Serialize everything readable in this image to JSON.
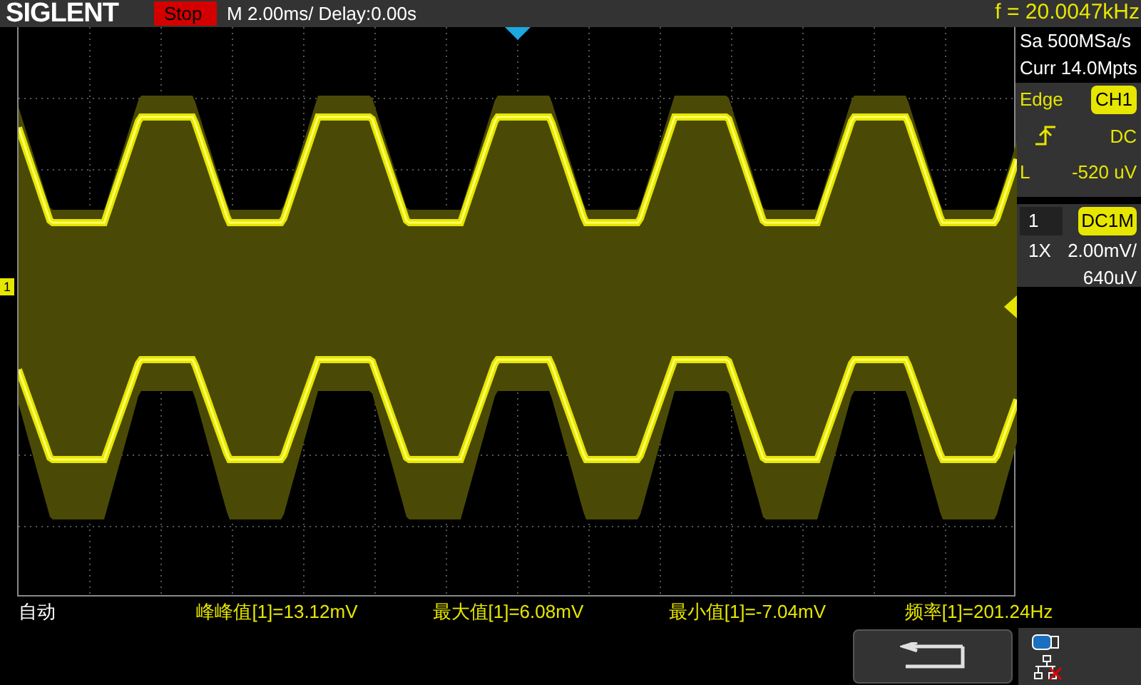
{
  "header": {
    "brand": "SIGLENT",
    "run_state": "Stop",
    "timebase": "M 2.00ms/ Delay:0.00s",
    "frequency": "f = 20.0047kHz"
  },
  "acquisition": {
    "sample_rate": "Sa 500MSa/s",
    "memory": "Curr 14.0Mpts"
  },
  "trigger": {
    "type": "Edge",
    "source": "CH1",
    "coupling": "DC",
    "level_label": "L",
    "level": "-520 uV"
  },
  "channel": {
    "number": "1",
    "coupling": "DC1M",
    "probe": "1X",
    "scale": "2.00mV/",
    "offset": "640uV"
  },
  "waveform": {
    "channel_marker": "1"
  },
  "footer": {
    "mode": "自动",
    "measurements": [
      "峰峰值[1]=13.12mV",
      "最大值[1]=6.08mV",
      "最小值[1]=-7.04mV",
      "频率[1]=201.24Hz"
    ]
  }
}
